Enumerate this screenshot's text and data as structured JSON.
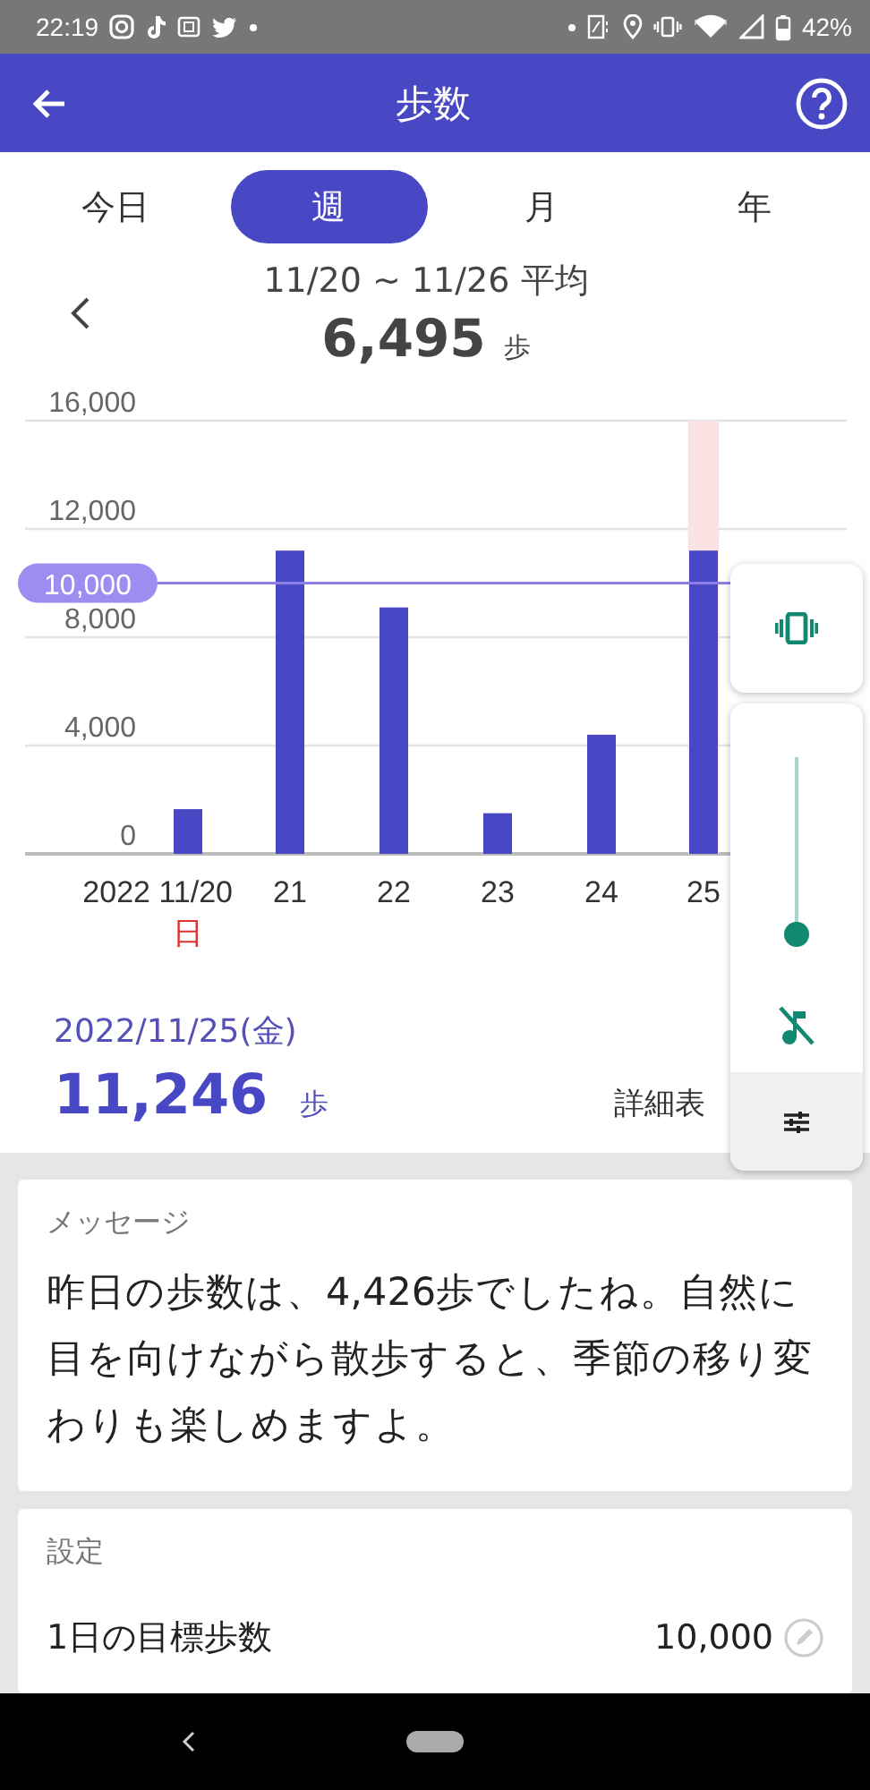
{
  "status_bar": {
    "time": "22:19",
    "battery": "42%"
  },
  "app_bar": {
    "title": "歩数"
  },
  "tabs": [
    {
      "label": "今日",
      "selected": false
    },
    {
      "label": "週",
      "selected": true
    },
    {
      "label": "月",
      "selected": false
    },
    {
      "label": "年",
      "selected": false
    }
  ],
  "period": {
    "range": "11/20 ~ 11/26 平均",
    "average": "6,495",
    "unit": "歩"
  },
  "chart": {
    "first_weekday": "日",
    "days": [
      {
        "selected": false
      },
      {
        "selected": false
      },
      {
        "selected": false
      },
      {
        "selected": false
      },
      {
        "selected": false
      },
      {
        "selected": true
      }
    ],
    "chart_data": {
      "type": "bar",
      "categories": [
        "2022 11/20",
        "21",
        "22",
        "23",
        "24",
        "25"
      ],
      "values": [
        1650,
        11200,
        9100,
        1500,
        4400,
        11200
      ],
      "grid": true,
      "ylim": [
        0,
        16000
      ],
      "yticks": [
        {
          "value": 0,
          "label": "0"
        },
        {
          "value": 4000,
          "label": "4,000"
        },
        {
          "value": 8000,
          "label": "8,000"
        },
        {
          "value": 12000,
          "label": "12,000"
        },
        {
          "value": 16000,
          "label": "16,000"
        }
      ],
      "ref_lines": [
        {
          "axis": "y",
          "value": 10000,
          "label": "10,000"
        }
      ]
    }
  },
  "selected_day": {
    "date": "2022/11/25(金)",
    "steps": "11,246",
    "unit": "歩",
    "detail_link": "詳細表"
  },
  "message": {
    "title": "メッセージ",
    "text": "昨日の歩数は、4,426歩でしたね。自然に目を向けながら散歩すると、季節の移り変わりも楽しめますよ。"
  },
  "settings": {
    "title": "設定",
    "rows": [
      {
        "label": "1日の目標歩数",
        "value": "10,000"
      }
    ]
  },
  "volume_panel": {
    "level": 0
  }
}
